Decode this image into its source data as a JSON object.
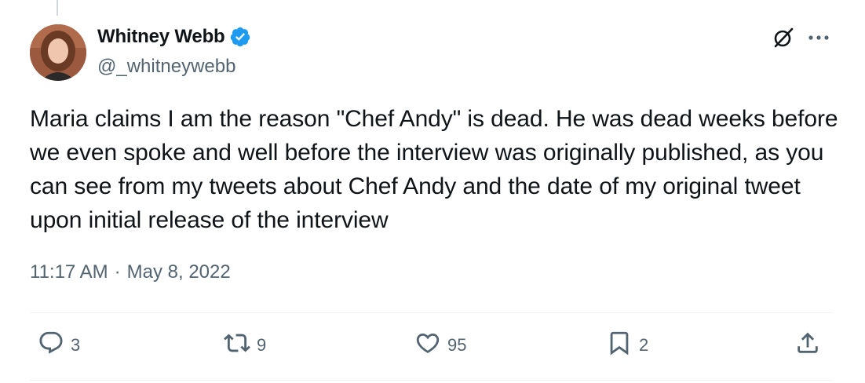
{
  "author": {
    "display_name": "Whitney Webb",
    "handle": "@_whitneywebb",
    "verified": true,
    "verified_color": "#1d9bf0"
  },
  "tweet": {
    "text": "Maria claims I am the reason \"Chef Andy\" is dead. He was dead weeks before we even spoke and well before the interview was originally published, as you can see from my tweets about Chef Andy and the date of my original tweet upon initial release of the interview",
    "time": "11:17 AM",
    "separator": "·",
    "date": "May 8, 2022"
  },
  "actions": {
    "replies": "3",
    "reposts": "9",
    "likes": "95",
    "bookmarks": "2"
  },
  "icons": [
    "grok-icon",
    "more-icon",
    "reply-icon",
    "repost-icon",
    "like-icon",
    "bookmark-icon",
    "share-icon",
    "verified-badge-icon"
  ],
  "colors": {
    "text": "#0f1419",
    "secondary": "#536471",
    "divider": "#eff3f4"
  }
}
